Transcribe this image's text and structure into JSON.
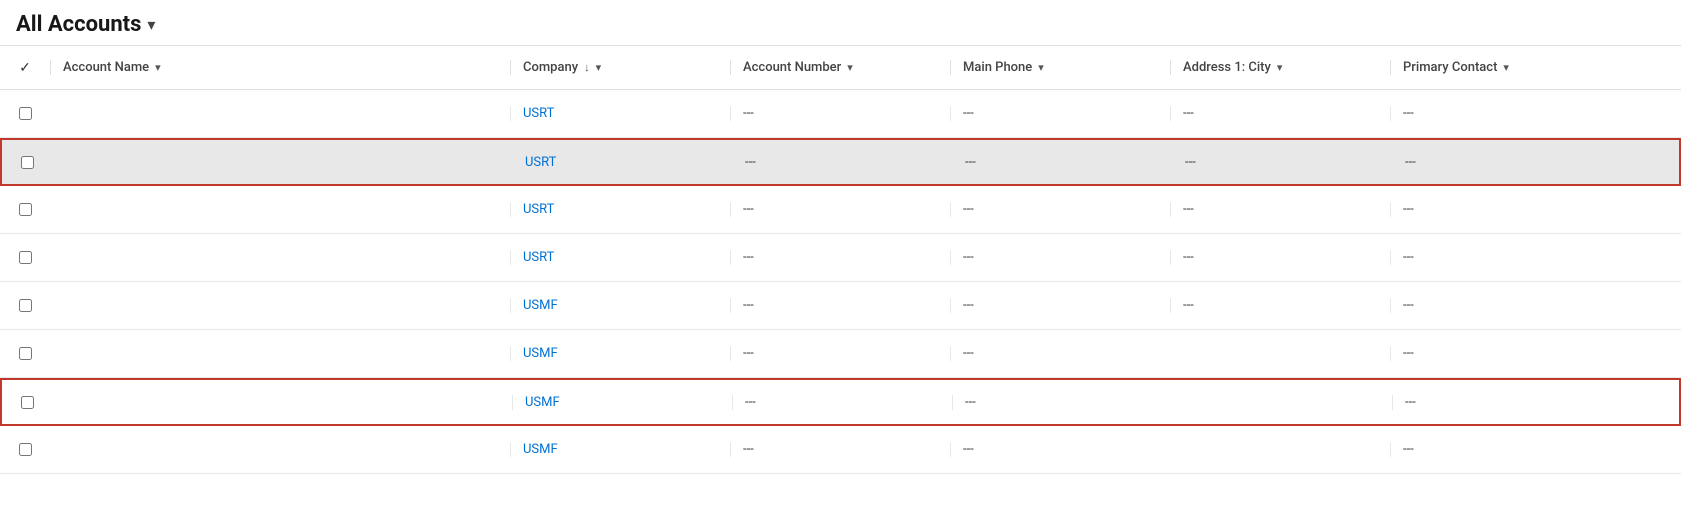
{
  "header": {
    "title": "All Accounts",
    "chevron": "▾"
  },
  "columns": {
    "check": "✓",
    "account_name": "Account Name",
    "company": "Company",
    "account_number": "Account Number",
    "main_phone": "Main Phone",
    "address_city": "Address 1: City",
    "primary_contact": "Primary Contact"
  },
  "rows": [
    {
      "id": 1,
      "account_name": "",
      "company": "USRT",
      "account_number": "---",
      "main_phone": "---",
      "address_city": "---",
      "primary_contact": "---",
      "highlighted": false,
      "outlined": false
    },
    {
      "id": 2,
      "account_name": "",
      "company": "USRT",
      "account_number": "---",
      "main_phone": "---",
      "address_city": "---",
      "primary_contact": "---",
      "highlighted": true,
      "outlined": false
    },
    {
      "id": 3,
      "account_name": "",
      "company": "USRT",
      "account_number": "---",
      "main_phone": "---",
      "address_city": "---",
      "primary_contact": "---",
      "highlighted": false,
      "outlined": false,
      "blurred": true
    },
    {
      "id": 4,
      "account_name": "",
      "company": "USRT",
      "account_number": "---",
      "main_phone": "---",
      "address_city": "---",
      "primary_contact": "---",
      "highlighted": false,
      "outlined": false,
      "blurred": true
    },
    {
      "id": 5,
      "account_name": "",
      "company": "USMF",
      "account_number": "---",
      "main_phone": "---",
      "address_city": "---",
      "primary_contact": "---",
      "highlighted": false,
      "outlined": false,
      "blurred": true
    },
    {
      "id": 6,
      "account_name": "",
      "company": "USMF",
      "account_number": "---",
      "main_phone": "---",
      "address_city": "",
      "primary_contact": "---",
      "highlighted": false,
      "outlined": false,
      "blurred": true
    },
    {
      "id": 7,
      "account_name": "",
      "company": "USMF",
      "account_number": "---",
      "main_phone": "---",
      "address_city": "",
      "primary_contact": "---",
      "highlighted": false,
      "outlined": true,
      "blurred": true
    },
    {
      "id": 8,
      "account_name": "",
      "company": "USMF",
      "account_number": "---",
      "main_phone": "---",
      "address_city": "",
      "primary_contact": "---",
      "highlighted": false,
      "outlined": false,
      "blurred": true
    }
  ]
}
